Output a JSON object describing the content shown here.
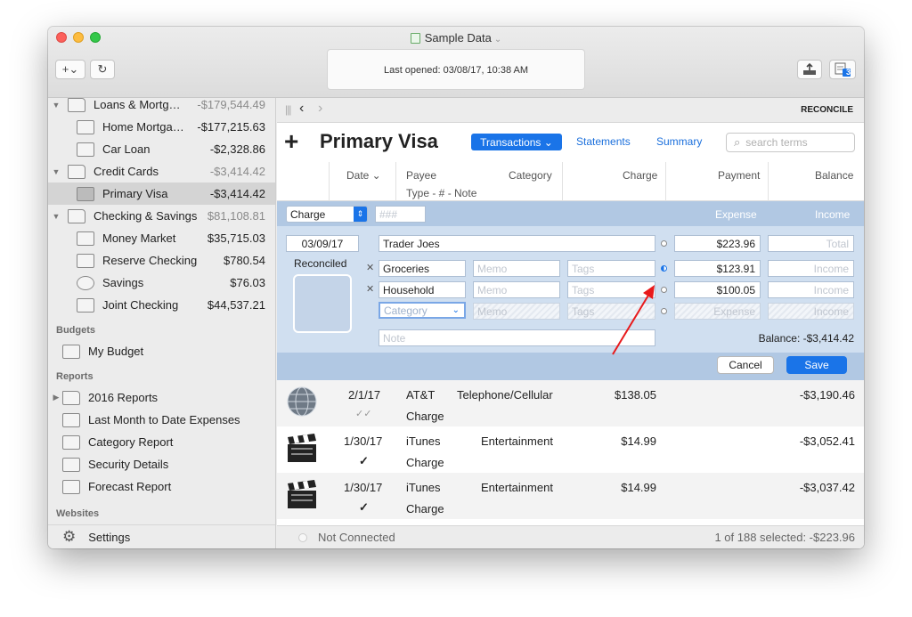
{
  "window": {
    "title": "Sample Data",
    "last_opened": "Last opened:  03/08/17, 10:38 AM",
    "badge": "3"
  },
  "toolbar": {
    "add_label": "+⌄",
    "refresh_icon": "refresh-icon",
    "export_icon": "export-icon",
    "calendar_icon": "calendar-icon"
  },
  "sidebar": {
    "accounts": [
      {
        "label": "Loans & Mortg…",
        "amount": "-$179,544.49",
        "group": true
      },
      {
        "label": "Home Mortga…",
        "amount": "-$177,215.63"
      },
      {
        "label": "Car Loan",
        "amount": "-$2,328.86"
      },
      {
        "label": "Credit Cards",
        "amount": "-$3,414.42",
        "group": true
      },
      {
        "label": "Primary Visa",
        "amount": "-$3,414.42"
      },
      {
        "label": "Checking & Savings",
        "amount": "$81,108.81",
        "group": true
      },
      {
        "label": "Money Market",
        "amount": "$35,715.03"
      },
      {
        "label": "Reserve Checking",
        "amount": "$780.54"
      },
      {
        "label": "Savings",
        "amount": "$76.03"
      },
      {
        "label": "Joint Checking",
        "amount": "$44,537.21"
      }
    ],
    "budgets_header": "Budgets",
    "budgets": [
      {
        "label": "My Budget"
      }
    ],
    "reports_header": "Reports",
    "reports": [
      {
        "label": "2016 Reports"
      },
      {
        "label": "Last Month to Date Expenses"
      },
      {
        "label": "Category Report"
      },
      {
        "label": "Security Details"
      },
      {
        "label": "Forecast Report"
      }
    ],
    "websites_header": "Websites",
    "settings": "Settings"
  },
  "nav": {
    "reconcile": "RECONCILE"
  },
  "header": {
    "plus": "+",
    "title": "Primary Visa",
    "tabs": [
      "Transactions ⌄",
      "Statements",
      "Summary"
    ],
    "search_placeholder": "search terms"
  },
  "columns": {
    "date": "Date ⌄",
    "payee": "Payee",
    "category": "Category",
    "type_line": "Type  -  #  -  Note",
    "charge": "Charge",
    "payment": "Payment",
    "balance": "Balance"
  },
  "editor": {
    "type": "Charge",
    "number_placeholder": "###",
    "expense_label": "Expense",
    "income_label": "Income",
    "date": "03/09/17",
    "payee": "Trader Joes",
    "total_charge": "$223.96",
    "total_placeholder": "Total",
    "status": "Reconciled",
    "splits": [
      {
        "category": "Groceries",
        "memo": "Memo",
        "tags": "Tags",
        "amount": "$123.91",
        "income": "Income"
      },
      {
        "category": "Household",
        "memo": "Memo",
        "tags": "Tags",
        "amount": "$100.05",
        "income": "Income"
      },
      {
        "category": "Category",
        "memo": "Memo",
        "tags": "Tags",
        "amount": "Expense",
        "income": "Income"
      }
    ],
    "note_placeholder": "Note",
    "balance": "Balance:  -$3,414.42",
    "cancel": "Cancel",
    "save": "Save"
  },
  "transactions": [
    {
      "date": "2/1/17",
      "payee": "AT&T",
      "category": "Telephone/Cellular",
      "type": "Charge",
      "charge": "$138.05",
      "balance": "-$3,190.46",
      "check": "✓✓",
      "icon": "globe-icon"
    },
    {
      "date": "1/30/17",
      "payee": "iTunes",
      "category": "Entertainment",
      "type": "Charge",
      "charge": "$14.99",
      "balance": "-$3,052.41",
      "check": "✓",
      "icon": "clapperboard-icon"
    },
    {
      "date": "1/30/17",
      "payee": "iTunes",
      "category": "Entertainment",
      "type": "Charge",
      "charge": "$14.99",
      "balance": "-$3,037.42",
      "check": "✓",
      "icon": "clapperboard-icon"
    }
  ],
  "status": {
    "connection": "Not Connected",
    "selection": "1 of 188 selected: -$223.96"
  },
  "colors": {
    "accent": "#1a74e8",
    "editor_bg": "#d0dff0",
    "annotation_arrow": "#e8191b"
  }
}
